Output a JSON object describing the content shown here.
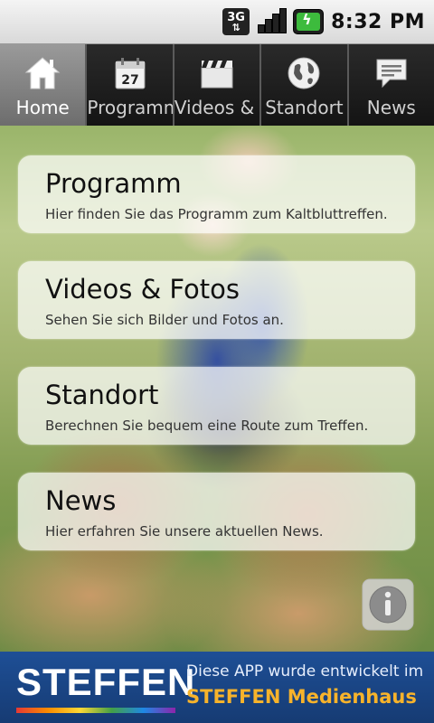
{
  "status": {
    "network": "3G",
    "time": "8:32 PM"
  },
  "tabs": [
    {
      "label": "Home",
      "icon": "home-icon"
    },
    {
      "label": "Programm",
      "icon": "calendar-icon",
      "icon_text": "27"
    },
    {
      "label": "Videos & Fotos",
      "icon": "clapperboard-icon"
    },
    {
      "label": "Standort",
      "icon": "globe-icon"
    },
    {
      "label": "News",
      "icon": "speech-bubble-icon"
    }
  ],
  "cards": [
    {
      "title": "Programm",
      "subtitle": "Hier finden Sie das Programm zum Kaltbluttreffen."
    },
    {
      "title": "Videos & Fotos",
      "subtitle": "Sehen Sie sich Bilder und Fotos an."
    },
    {
      "title": "Standort",
      "subtitle": "Berechnen Sie bequem eine Route zum Treffen."
    },
    {
      "title": "News",
      "subtitle": "Hier erfahren Sie unsere aktuellen News."
    }
  ],
  "footer": {
    "brand": "STEFFEN",
    "line1": "Diese APP wurde entwickelt im",
    "line2": "STEFFEN Medienhaus"
  },
  "colors": {
    "footer_bg": "#1e4f96",
    "footer_accent": "#f7b32b"
  }
}
